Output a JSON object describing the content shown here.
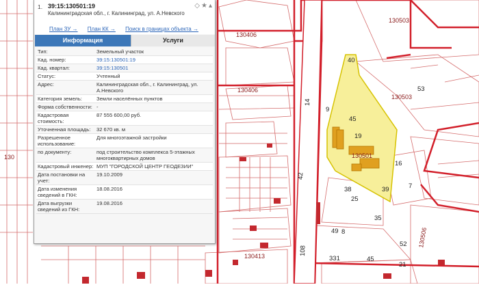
{
  "panel": {
    "index": "1.",
    "cad_number": "39:15:130501:19",
    "address": "Калининградская обл., г. Калининград, ул. А.Невского",
    "links": [
      "План ЗУ →",
      "План КК →",
      "Поиск в границах объекта →"
    ],
    "tabs": [
      "Информация",
      "Услуги"
    ],
    "rows": [
      {
        "k": "Тип:",
        "v": "Земельный участок"
      },
      {
        "k": "Кад. номер:",
        "v": "39:15:130501:19",
        "link": true
      },
      {
        "k": "Кад. квартал:",
        "v": "39:15:130501",
        "link": true
      },
      {
        "k": "Статус:",
        "v": "Учтенный"
      },
      {
        "k": "Адрес:",
        "v": "Калининградская обл., г. Калининград, ул. А.Невского"
      },
      {
        "k": "Категория земель:",
        "v": "Земли населённых пунктов"
      },
      {
        "k": "Форма собственности:",
        "v": "-"
      },
      {
        "k": "Кадастровая стоимость:",
        "v": "87 555 600,00 руб."
      },
      {
        "k": "Уточненная площадь:",
        "v": "32 670 кв. м"
      },
      {
        "k": "Разрешенное использование:",
        "v": "Для многоэтажной застройки"
      },
      {
        "k": "по документу:",
        "v": "под строительство комплекса 5-этажных многоквартирных домов"
      },
      {
        "k": "Кадастровый инженер:",
        "v": "МУП \"ГОРОДСКОЙ ЦЕНТР ГЕОДЕЗИИ\""
      },
      {
        "k": "Дата постановки на учет:",
        "v": "19.10.2009"
      },
      {
        "k": "Дата изменения сведений в ГКН:",
        "v": "18.08.2016"
      },
      {
        "k": "Дата выгрузки сведений из ГКН:",
        "v": "19.08.2016"
      }
    ]
  },
  "map": {
    "labels": [
      "130406",
      "130503",
      "130406",
      "130501",
      "130503",
      "130506",
      "130413",
      "130",
      "40",
      "45",
      "19",
      "9",
      "14",
      "53",
      "16",
      "7",
      "38",
      "25",
      "35",
      "49",
      "8",
      "45",
      "39",
      "331",
      "42",
      "108",
      "52",
      "21"
    ]
  },
  "colors": {
    "parcel_fill": "#f7ef9a",
    "parcel_stroke": "#d6c200",
    "boundary": "#d21f2a",
    "panel_tab": "#3c77b8"
  }
}
